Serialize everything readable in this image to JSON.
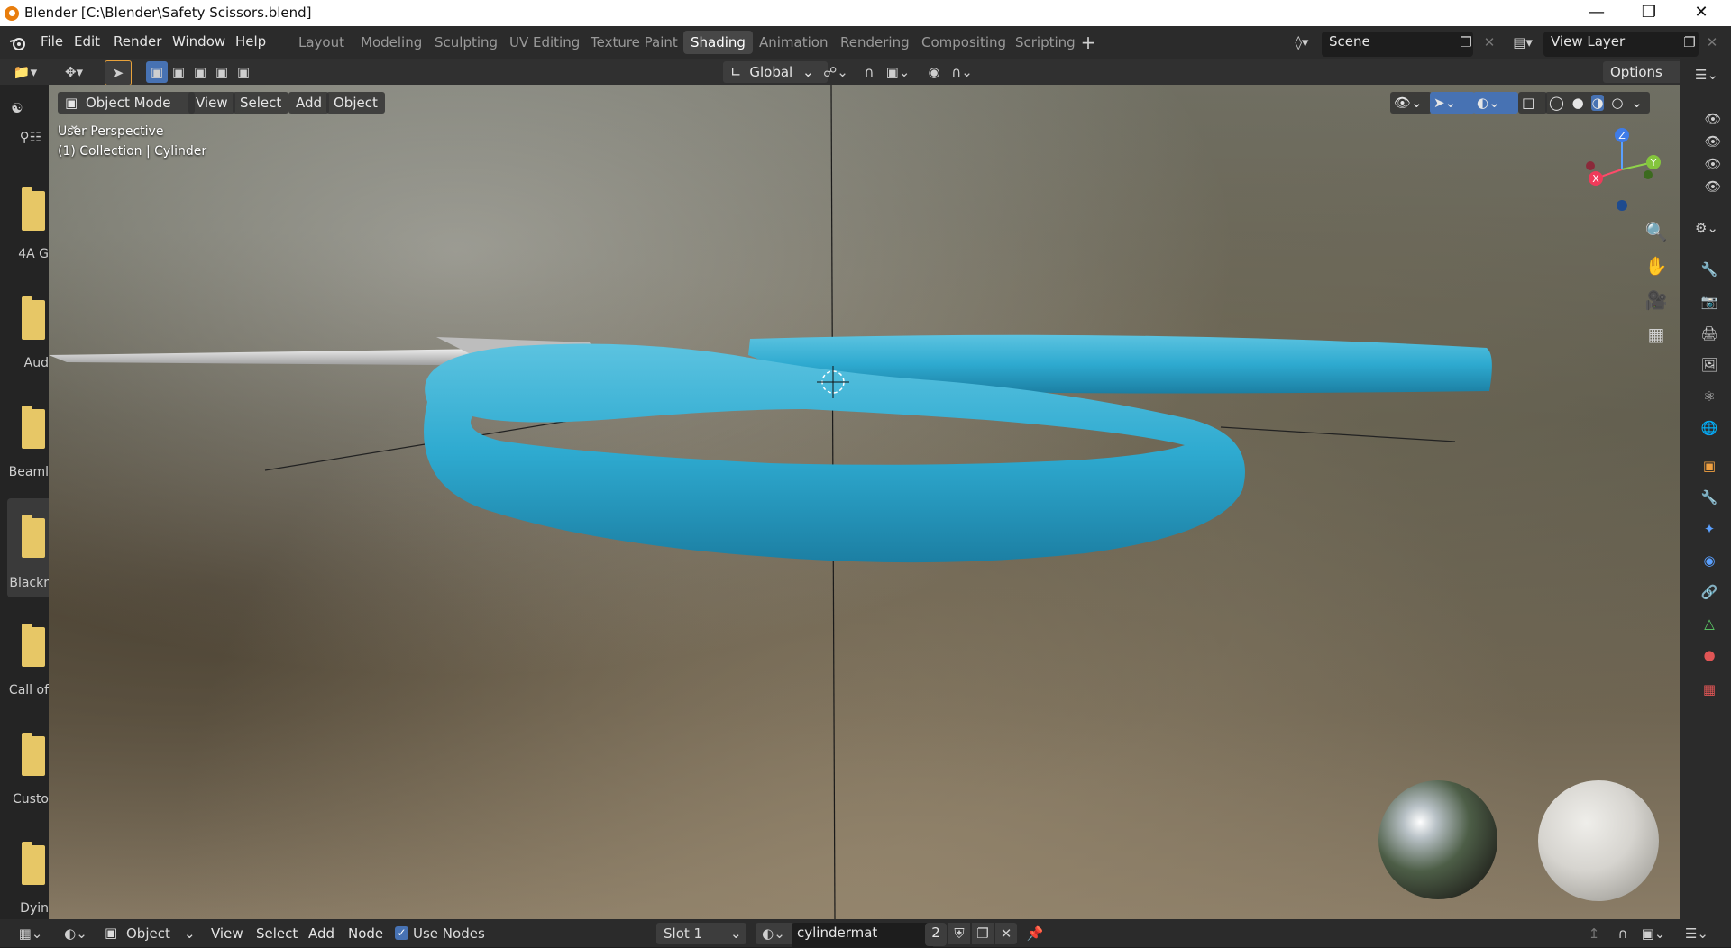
{
  "window": {
    "title": "Blender [C:\\Blender\\Safety Scissors.blend]",
    "controls": [
      "minimize-icon",
      "maximize-icon",
      "close-icon"
    ]
  },
  "menu": {
    "file": "File",
    "edit": "Edit",
    "render": "Render",
    "window": "Window",
    "help": "Help"
  },
  "workspaces": [
    {
      "label": "Layout",
      "active": false
    },
    {
      "label": "Modeling",
      "active": false
    },
    {
      "label": "Sculpting",
      "active": false
    },
    {
      "label": "UV Editing",
      "active": false
    },
    {
      "label": "Texture Paint",
      "active": false
    },
    {
      "label": "Shading",
      "active": true
    },
    {
      "label": "Animation",
      "active": false
    },
    {
      "label": "Rendering",
      "active": false
    },
    {
      "label": "Compositing",
      "active": false
    },
    {
      "label": "Scripting",
      "active": false
    }
  ],
  "scene": {
    "name": "Scene",
    "view_layer": "View Layer"
  },
  "tool_header": {
    "transform_orientation": "Global",
    "options_label": "Options"
  },
  "viewport": {
    "mode": "Object Mode",
    "menus": {
      "view": "View",
      "select": "Select",
      "add": "Add",
      "object": "Object"
    },
    "perspective_text": "User Perspective",
    "collection_text": "(1) Collection | Cylinder",
    "gizmo_axes": {
      "x": "X",
      "y": "Y",
      "z": "Z"
    },
    "object_color": "#2eaad0"
  },
  "file_browser": {
    "items": [
      "4A G",
      "Aud",
      "Beaml",
      "Blackr",
      "Call of",
      "Custo",
      "Dyin"
    ]
  },
  "shader_editor_header": {
    "object_type": "Object",
    "view": "View",
    "select": "Select",
    "add": "Add",
    "node": "Node",
    "use_nodes": "Use Nodes",
    "use_nodes_checked": true,
    "slot": "Slot 1",
    "material_name": "cylindermat",
    "material_users": "2"
  },
  "colors": {
    "accent": "#4772b3",
    "active_tab": "#474747",
    "folder": "#e7c766"
  }
}
